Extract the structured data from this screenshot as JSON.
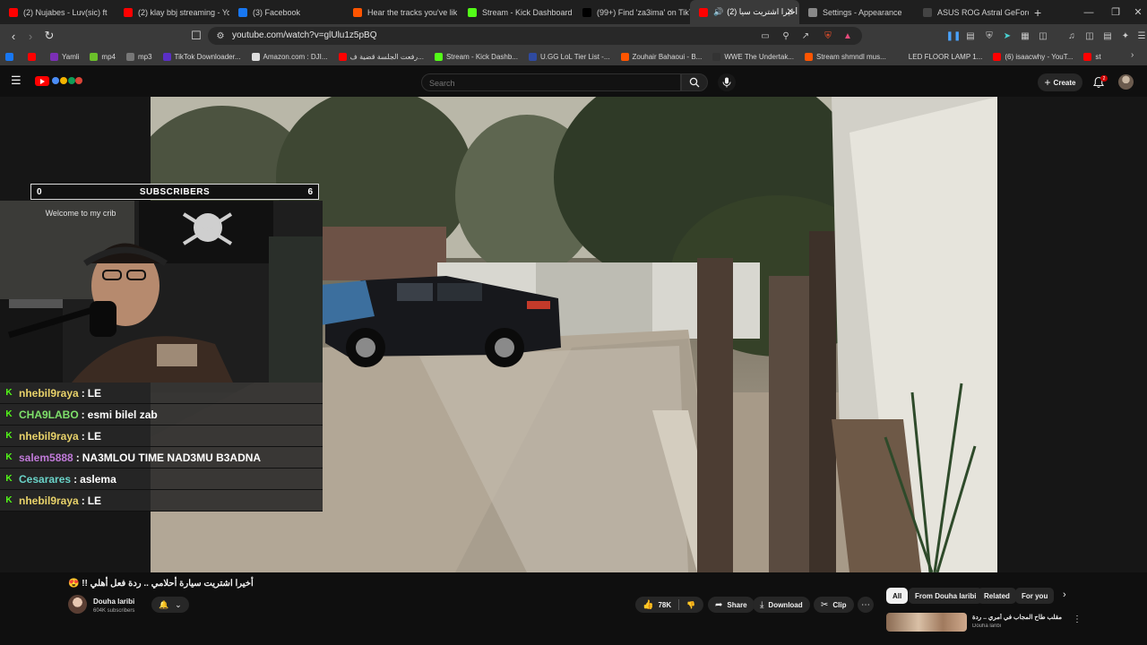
{
  "browser": {
    "tabs": [
      {
        "title": "(2) Nujabes - Luv(sic) ft",
        "favicon": "youtube-icon",
        "color": "#ff0000"
      },
      {
        "title": "(2) klay bbj streaming - Yo",
        "favicon": "youtube-icon",
        "color": "#ff0000"
      },
      {
        "title": "(3) Facebook",
        "favicon": "facebook-icon",
        "color": "#1877f2"
      },
      {
        "title": "Hear the tracks you've lik",
        "favicon": "soundcloud-icon",
        "color": "#ff5500"
      },
      {
        "title": "Stream - Kick Dashboard",
        "favicon": "kick-icon",
        "color": "#53fc18"
      },
      {
        "title": "(99+) Find 'za3ima' on TikT",
        "favicon": "tiktok-icon",
        "color": "#000000"
      },
      {
        "title": "(2) أخيرا اشتريت سيا",
        "favicon": "youtube-icon",
        "color": "#ff0000",
        "active": true
      },
      {
        "title": "Settings - Appearance",
        "favicon": "gear-icon",
        "color": "#888888"
      },
      {
        "title": "ASUS ROG Astral GeForce",
        "favicon": "asus-icon",
        "color": "#444444"
      }
    ],
    "url": "youtube.com/watch?v=glUlu1z5pBQ",
    "bookmarks": [
      {
        "label": "",
        "color": "#1877f2"
      },
      {
        "label": "",
        "color": "#ff0000"
      },
      {
        "label": "Yamli",
        "color": "#7b2fb5"
      },
      {
        "label": "mp4",
        "color": "#6bbf2a"
      },
      {
        "label": "mp3",
        "color": "#777777"
      },
      {
        "label": "TikTok Downloader...",
        "color": "#5a2fc5"
      },
      {
        "label": "Amazon.com : DJI...",
        "color": "#dddddd"
      },
      {
        "label": "رفعت الجلسة قضية ف...",
        "color": "#ff0000"
      },
      {
        "label": "Stream - Kick Dashb...",
        "color": "#53fc18"
      },
      {
        "label": "U.GG LoL Tier List -...",
        "color": "#2f4aa0"
      },
      {
        "label": "Zouhair Bahaoui - B...",
        "color": "#ff5500"
      },
      {
        "label": "WWE The Undertak...",
        "color": "#333333"
      },
      {
        "label": "Stream shmndl mus...",
        "color": "#ff5500"
      },
      {
        "label": "LED FLOOR LAMP 1...",
        "color": "#3a3a3a"
      },
      {
        "label": "(6) isaacwhy - YouT...",
        "color": "#ff0000"
      },
      {
        "label": "st",
        "color": "#ff0000"
      }
    ]
  },
  "youtube": {
    "search_placeholder": "Search",
    "create_label": "Create",
    "notifications_badge": "2"
  },
  "overlay": {
    "subs_left": "0",
    "subs_label": "SUBSCRIBERS",
    "subs_right": "6",
    "welcome_text": "Welcome to my crib",
    "chat": [
      {
        "user": "nhebil9raya",
        "color": "#e8d26a",
        "message": "LE"
      },
      {
        "user": "CHA9LABO",
        "color": "#7ee06a",
        "message": "esmi bilel zab"
      },
      {
        "user": "nhebil9raya",
        "color": "#e8d26a",
        "message": "LE"
      },
      {
        "user": "salem5888",
        "color": "#c07ad8",
        "message": "NA3MLOU TIME NAD3MU B3ADNA"
      },
      {
        "user": "Cesarares",
        "color": "#6ad3c8",
        "message": "aslema"
      },
      {
        "user": "nhebil9raya",
        "color": "#e8d26a",
        "message": "LE"
      }
    ]
  },
  "video": {
    "title": "أخيرا اشتريت سيارة أحلامي .. ردة فعل أهلي !! 😍",
    "channel": "Douha laribi",
    "subscribers": "604K subscribers",
    "likes": "78K",
    "share_label": "Share",
    "download_label": "Download",
    "clip_label": "Clip"
  },
  "sidebar": {
    "chips": [
      "All",
      "From Douha laribi",
      "Related",
      "For you"
    ],
    "rec_title": "مقلب طاح المجاب في أمري .. ردة فعله",
    "rec_sub": "Douha laribi"
  }
}
